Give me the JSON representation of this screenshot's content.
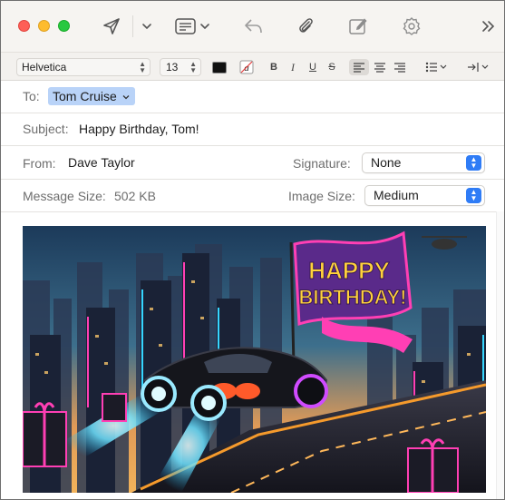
{
  "toolbar": {
    "send_icon": "paper-plane-icon",
    "header_fields_icon": "list-window-icon",
    "reply_icon": "reply-arrow-icon",
    "attach_icon": "paperclip-icon",
    "markup_icon": "compose-pencil-icon",
    "photo_browser_icon": "sticker-icon",
    "more_icon": "double-chevron-right-icon"
  },
  "format": {
    "font": "Helvetica",
    "size": "13",
    "text_color": "#111111",
    "bold": "B",
    "italic": "I",
    "underline": "U",
    "strikethrough": "S",
    "background_glyph": "a"
  },
  "header": {
    "to_label": "To:",
    "to_recipient": "Tom Cruise",
    "subject_label": "Subject:",
    "subject_value": "Happy Birthday, Tom!",
    "from_label": "From:",
    "from_value": "Dave Taylor",
    "signature_label": "Signature:",
    "signature_value": "None",
    "message_size_label": "Message Size:",
    "message_size_value": "502 KB",
    "image_size_label": "Image Size:",
    "image_size_value": "Medium"
  },
  "body": {
    "image_flag_line1": "HAPPY",
    "image_flag_line2": "BIRTHDAY!"
  },
  "colors": {
    "accent": "#2f7cf6",
    "token": "#b9d3f8"
  }
}
